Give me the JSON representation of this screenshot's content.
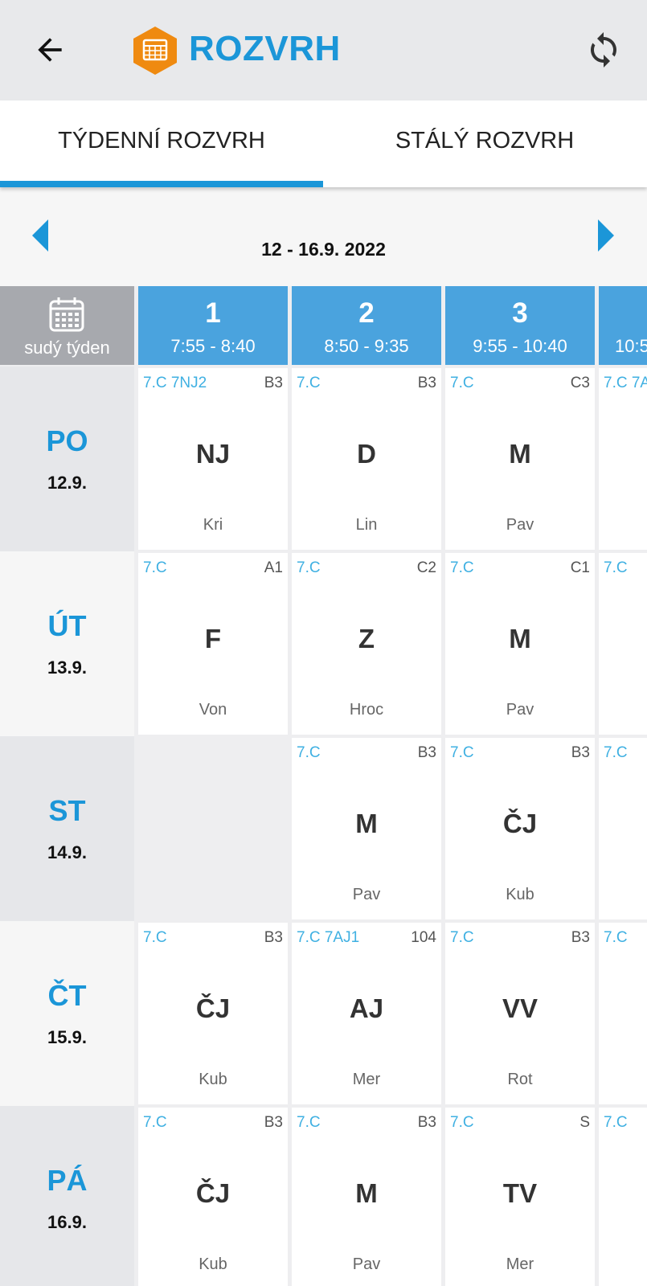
{
  "header": {
    "title": "ROZVRH",
    "icons": {
      "back": "arrow-left-icon",
      "logo": "timetable-icon",
      "refresh": "refresh-icon"
    },
    "colors": {
      "accent": "#1b96d8",
      "logo_bg": "#ef8a10"
    }
  },
  "tabs": [
    {
      "label": "TÝDENNÍ ROZVRH",
      "selected": true
    },
    {
      "label": "STÁLÝ ROZVRH",
      "selected": false
    }
  ],
  "week": {
    "label": "12 - 16.9. 2022"
  },
  "corner": {
    "label": "sudý týden",
    "icon": "calendar-icon"
  },
  "periods": [
    {
      "num": "1",
      "time": "7:55 - 8:40"
    },
    {
      "num": "2",
      "time": "8:50 - 9:35"
    },
    {
      "num": "3",
      "time": "9:55 - 10:40"
    },
    {
      "num": "",
      "time": "10:5"
    }
  ],
  "days": [
    {
      "abbr": "PO",
      "date": "12.9.",
      "lessons": [
        {
          "cls": "7.C 7NJ2",
          "room": "B3",
          "subject": "NJ",
          "teacher": "Kri"
        },
        {
          "cls": "7.C",
          "room": "B3",
          "subject": "D",
          "teacher": "Lin"
        },
        {
          "cls": "7.C",
          "room": "C3",
          "subject": "M",
          "teacher": "Pav"
        },
        {
          "cls": "7.C 7A",
          "room": "",
          "subject": "",
          "teacher": ""
        }
      ]
    },
    {
      "abbr": "ÚT",
      "date": "13.9.",
      "lessons": [
        {
          "cls": "7.C",
          "room": "A1",
          "subject": "F",
          "teacher": "Von"
        },
        {
          "cls": "7.C",
          "room": "C2",
          "subject": "Z",
          "teacher": "Hroc"
        },
        {
          "cls": "7.C",
          "room": "C1",
          "subject": "M",
          "teacher": "Pav"
        },
        {
          "cls": "7.C",
          "room": "",
          "subject": "",
          "teacher": ""
        }
      ]
    },
    {
      "abbr": "ST",
      "date": "14.9.",
      "lessons": [
        {
          "empty": true
        },
        {
          "cls": "7.C",
          "room": "B3",
          "subject": "M",
          "teacher": "Pav"
        },
        {
          "cls": "7.C",
          "room": "B3",
          "subject": "ČJ",
          "teacher": "Kub"
        },
        {
          "cls": "7.C",
          "room": "",
          "subject": "",
          "teacher": ""
        }
      ]
    },
    {
      "abbr": "ČT",
      "date": "15.9.",
      "lessons": [
        {
          "cls": "7.C",
          "room": "B3",
          "subject": "ČJ",
          "teacher": "Kub"
        },
        {
          "cls": "7.C 7AJ1",
          "room": "104",
          "subject": "AJ",
          "teacher": "Mer"
        },
        {
          "cls": "7.C",
          "room": "B3",
          "subject": "VV",
          "teacher": "Rot"
        },
        {
          "cls": "7.C",
          "room": "",
          "subject": "",
          "teacher": ""
        }
      ]
    },
    {
      "abbr": "PÁ",
      "date": "16.9.",
      "lessons": [
        {
          "cls": "7.C",
          "room": "B3",
          "subject": "ČJ",
          "teacher": "Kub"
        },
        {
          "cls": "7.C",
          "room": "B3",
          "subject": "M",
          "teacher": "Pav"
        },
        {
          "cls": "7.C",
          "room": "S",
          "subject": "TV",
          "teacher": "Mer"
        },
        {
          "cls": "7.C",
          "room": "",
          "subject": "",
          "teacher": ""
        }
      ]
    }
  ]
}
